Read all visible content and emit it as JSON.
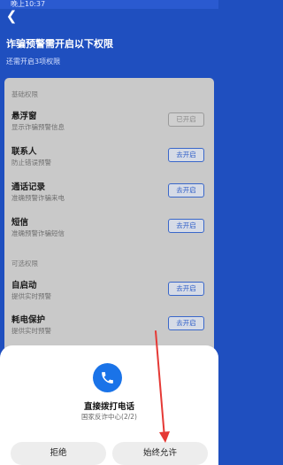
{
  "status_bar": {
    "text": "晚上10:37"
  },
  "header": {
    "title": "诈骗预警需开启以下权限",
    "subtitle": "还需开启3项权限"
  },
  "sections": {
    "basic": "基础权限",
    "optional": "可选权限"
  },
  "permissions": [
    {
      "title": "悬浮窗",
      "desc": "显示诈骗预警信息",
      "button": "已开启"
    },
    {
      "title": "联系人",
      "desc": "防止错误预警",
      "button": "去开启"
    },
    {
      "title": "通话记录",
      "desc": "准确预警诈骗来电",
      "button": "去开启"
    },
    {
      "title": "短信",
      "desc": "准确预警诈骗短信",
      "button": "去开启"
    },
    {
      "title": "自启动",
      "desc": "提供实时预警",
      "button": "去开启"
    },
    {
      "title": "耗电保护",
      "desc": "提供实时预警",
      "button": "去开启"
    }
  ],
  "dialog": {
    "icon": "phone-icon",
    "title": "直接拨打电话",
    "subtitle": "国家反诈中心(2/2)",
    "deny_label": "拒绝",
    "allow_label": "始终允许"
  },
  "colors": {
    "header_bg": "#1f4fbf",
    "accent": "#1a73e8",
    "annotation_arrow": "#e53935"
  }
}
